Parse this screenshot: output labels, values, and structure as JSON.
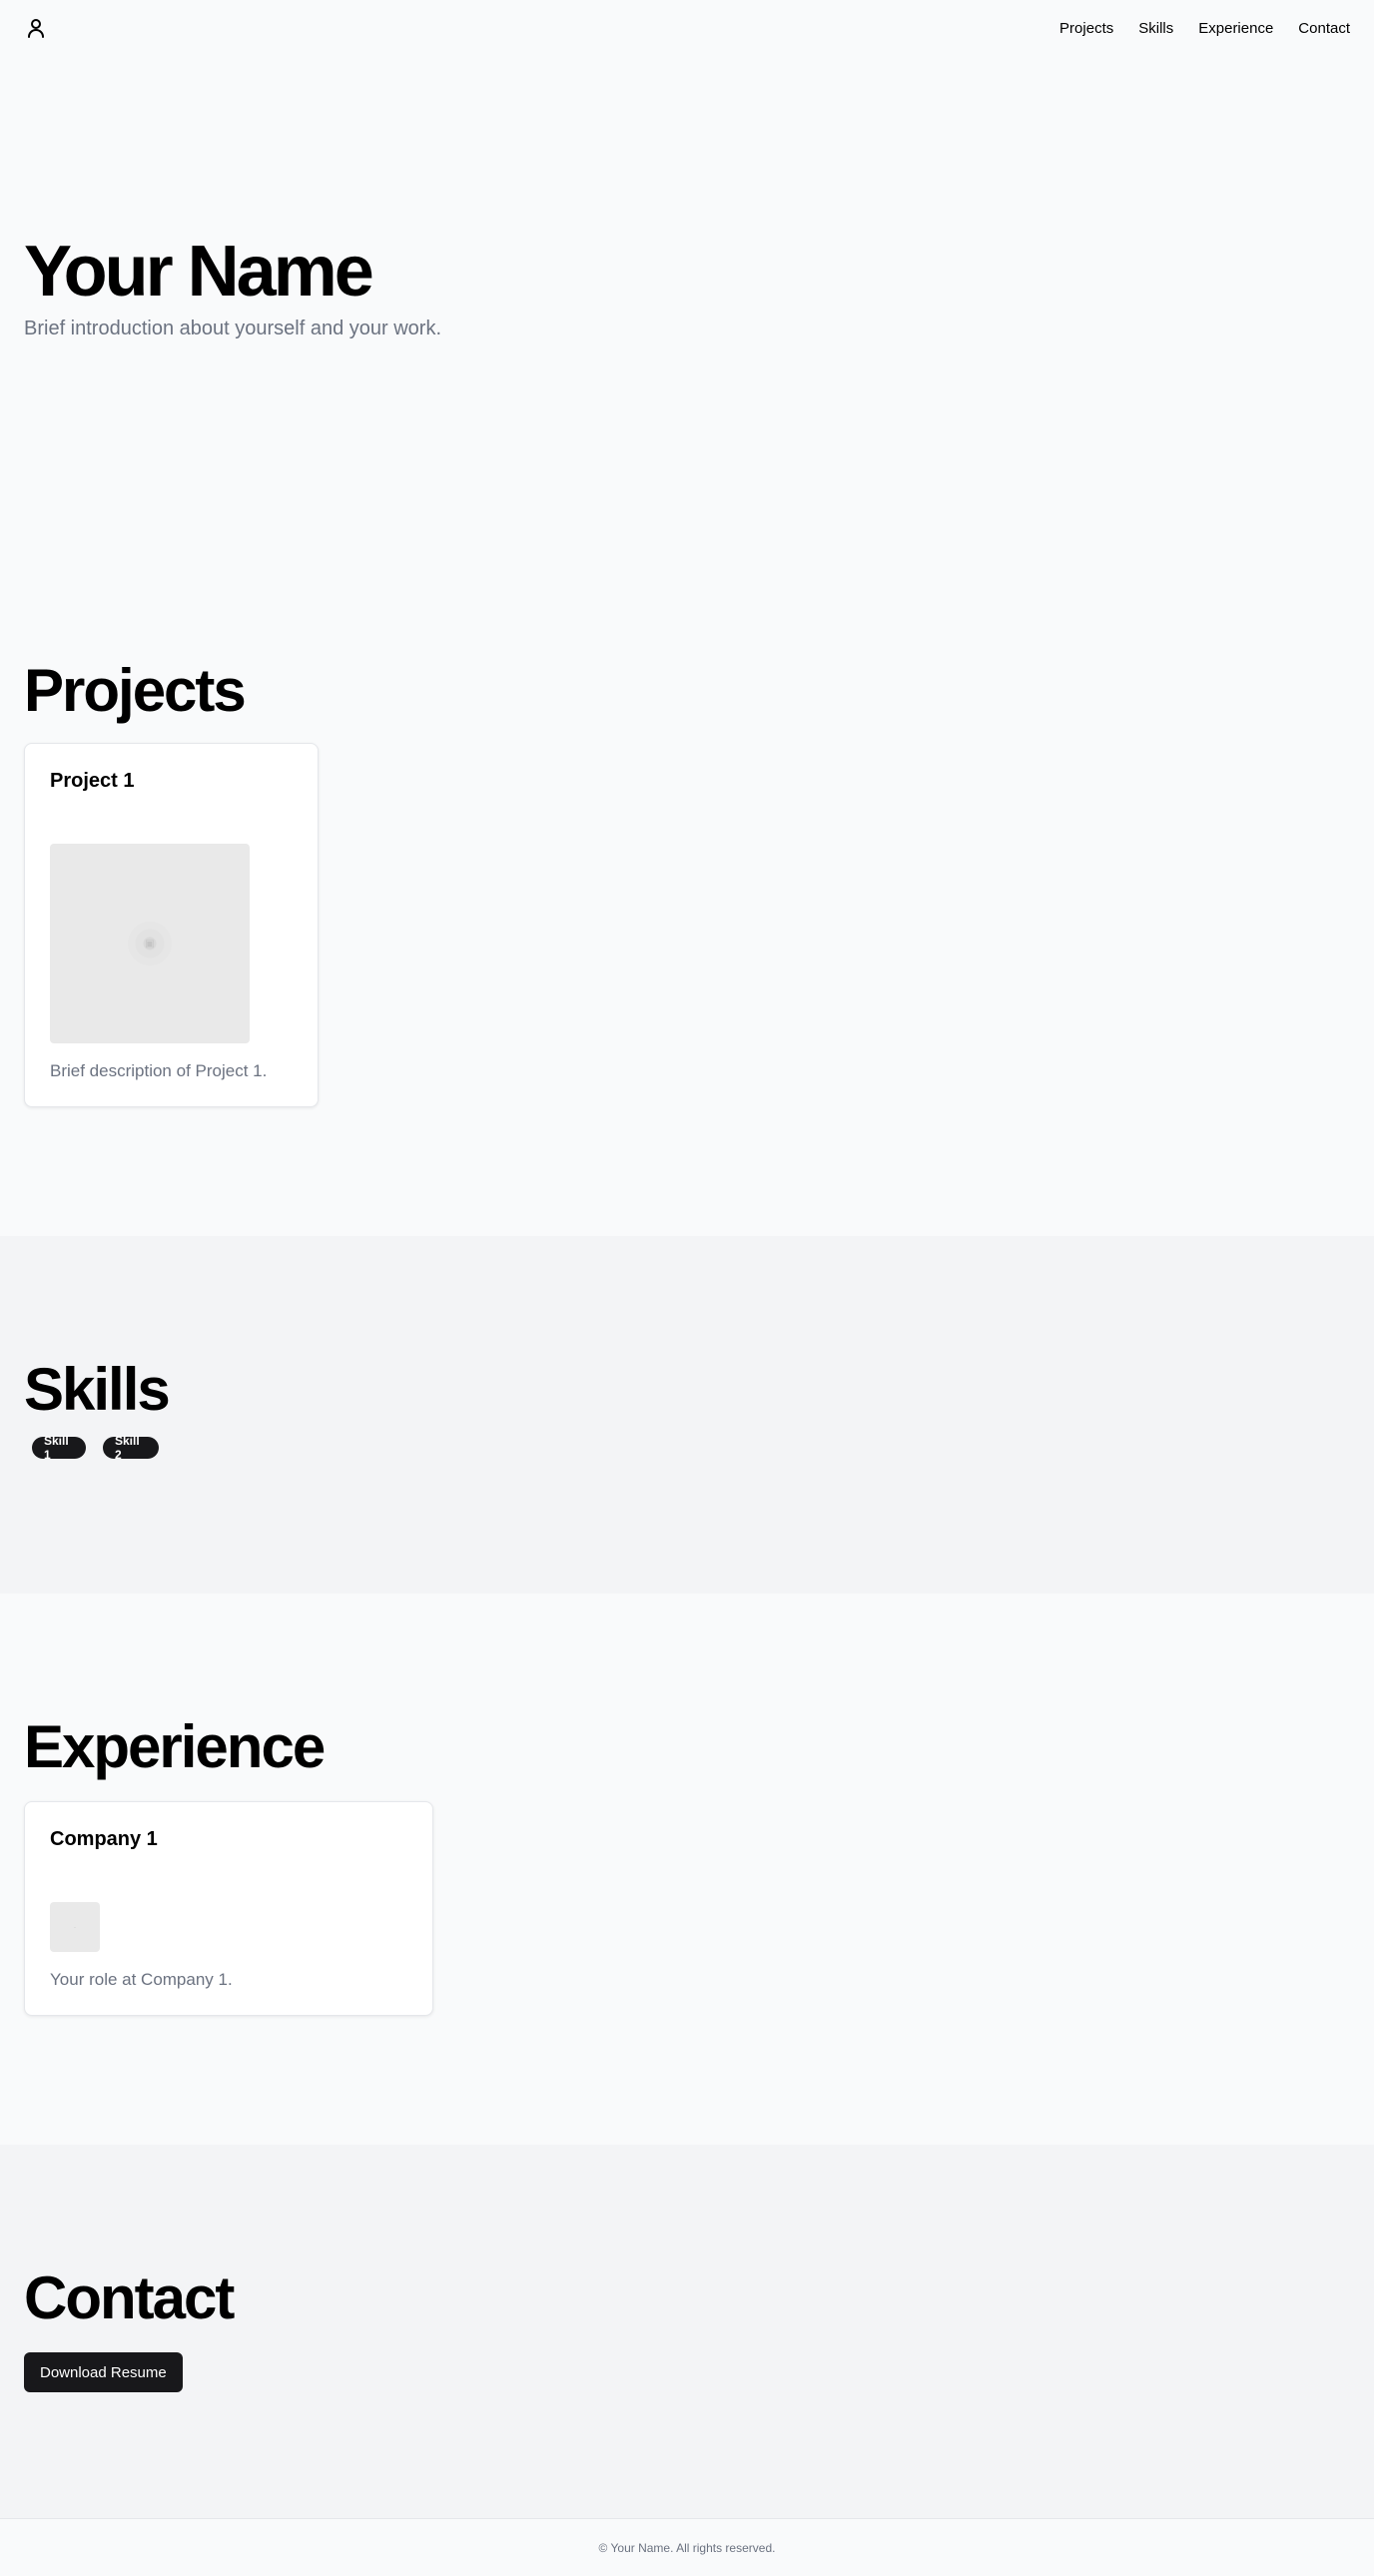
{
  "header": {
    "logo_icon": "user-icon",
    "nav": [
      {
        "label": "Projects"
      },
      {
        "label": "Skills"
      },
      {
        "label": "Experience"
      },
      {
        "label": "Contact"
      }
    ]
  },
  "hero": {
    "title": "Your Name",
    "subtitle": "Brief introduction about yourself and your work."
  },
  "projects": {
    "title": "Projects",
    "items": [
      {
        "title": "Project 1",
        "description": "Brief description of Project 1.",
        "image_icon": "image-placeholder-icon"
      }
    ]
  },
  "skills": {
    "title": "Skills",
    "items": [
      {
        "label": "Skill 1"
      },
      {
        "label": "Skill 2"
      }
    ]
  },
  "experience": {
    "title": "Experience",
    "items": [
      {
        "company": "Company 1",
        "role": "Your role at Company 1.",
        "logo_icon": "company-logo-placeholder-icon"
      }
    ]
  },
  "contact": {
    "title": "Contact",
    "resume_button": "Download Resume"
  },
  "footer": {
    "text": "© Your Name. All rights reserved."
  },
  "colors": {
    "background": "#f9fafb",
    "section_alt": "#f3f4f6",
    "primary_dark": "#18181b",
    "muted_text": "#6b7280",
    "card_border": "#e5e7eb"
  }
}
